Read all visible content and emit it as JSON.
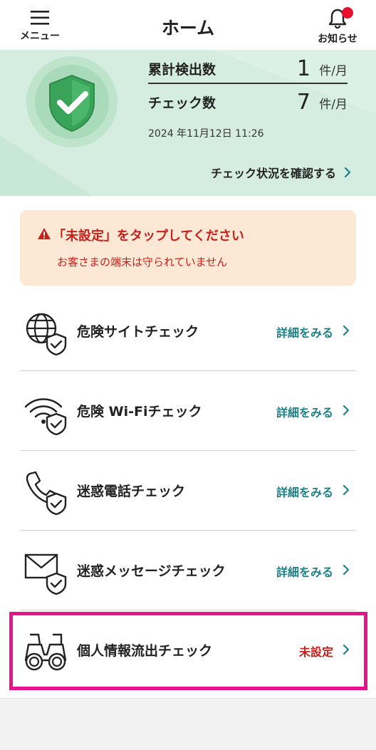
{
  "header": {
    "menu_label": "メニュー",
    "title": "ホーム",
    "notice_label": "お知らせ",
    "notice_dot_color": "#e8102b"
  },
  "status": {
    "detections_label": "累計検出数",
    "detections_value": "1",
    "detections_unit": "件/月",
    "checks_label": "チェック数",
    "checks_value": "7",
    "checks_unit": "件/月",
    "timestamp": "2024 年11月12日 11:26",
    "link_label": "チェック状況を確認する",
    "shield_icon": "shield-check-icon",
    "shield_color": "#3aa35a"
  },
  "alert": {
    "title": "「未設定」をタップしてください",
    "message": "お客さまの端末は守られていません",
    "color": "#c8201a"
  },
  "features": [
    {
      "icon": "globe-shield-icon",
      "label": "危険サイトチェック",
      "action": "詳細をみる",
      "state": "detail"
    },
    {
      "icon": "wifi-shield-icon",
      "label": "危険 Wi-Fiチェック",
      "action": "詳細をみる",
      "state": "detail"
    },
    {
      "icon": "phone-shield-icon",
      "label": "迷惑電話チェック",
      "action": "詳細をみる",
      "state": "detail"
    },
    {
      "icon": "mail-shield-icon",
      "label": "迷惑メッセージチェック",
      "action": "詳細をみる",
      "state": "detail"
    },
    {
      "icon": "binoculars-icon",
      "label": "個人情報流出チェック",
      "action": "未設定",
      "state": "unset"
    }
  ],
  "colors": {
    "accent_teal": "#1f7f86",
    "warning_red": "#c8201a",
    "highlight_pink": "#e8138c"
  }
}
